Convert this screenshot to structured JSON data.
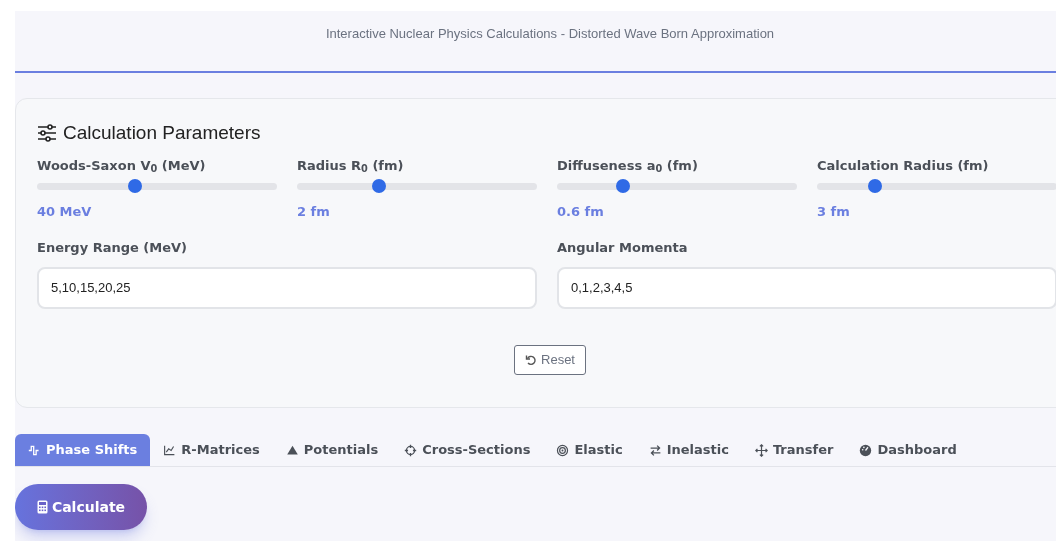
{
  "header": {
    "subtitle": "Interactive Nuclear Physics Calculations - Distorted Wave Born Approximation"
  },
  "parameters": {
    "title": "Calculation Parameters",
    "sliders": [
      {
        "label": "Woods-Saxon V$_{0}$ (MeV)",
        "level": 0.41,
        "reading": "40 MeV"
      },
      {
        "label": "Radius R$_{0}$ (fm)",
        "level": 0.34,
        "reading": "2 fm"
      },
      {
        "label": "Diffuseness a$_{0}$ (fm)",
        "level": 0.275,
        "reading": "0.6 fm"
      },
      {
        "label": "Calculation Radius (fm)",
        "level": 0.24,
        "reading": "3 fm"
      }
    ],
    "fields": [
      {
        "label": "Energy Range (MeV)",
        "value": "5,10,15,20,25"
      },
      {
        "label": "Angular Momenta",
        "value": "0,1,2,3,4,5"
      }
    ],
    "reset_button": "Reset"
  },
  "tabs": [
    {
      "label": "Phase Shifts",
      "selected": true
    },
    {
      "label": "R-Matrices",
      "selected": false
    },
    {
      "label": "Potentials",
      "selected": false
    },
    {
      "label": "Cross-Sections",
      "selected": false
    },
    {
      "label": "Elastic",
      "selected": false
    },
    {
      "label": "Inelastic",
      "selected": false
    },
    {
      "label": "Transfer",
      "selected": false
    },
    {
      "label": "Dashboard",
      "selected": false
    }
  ],
  "calculate_button": "Calculate"
}
